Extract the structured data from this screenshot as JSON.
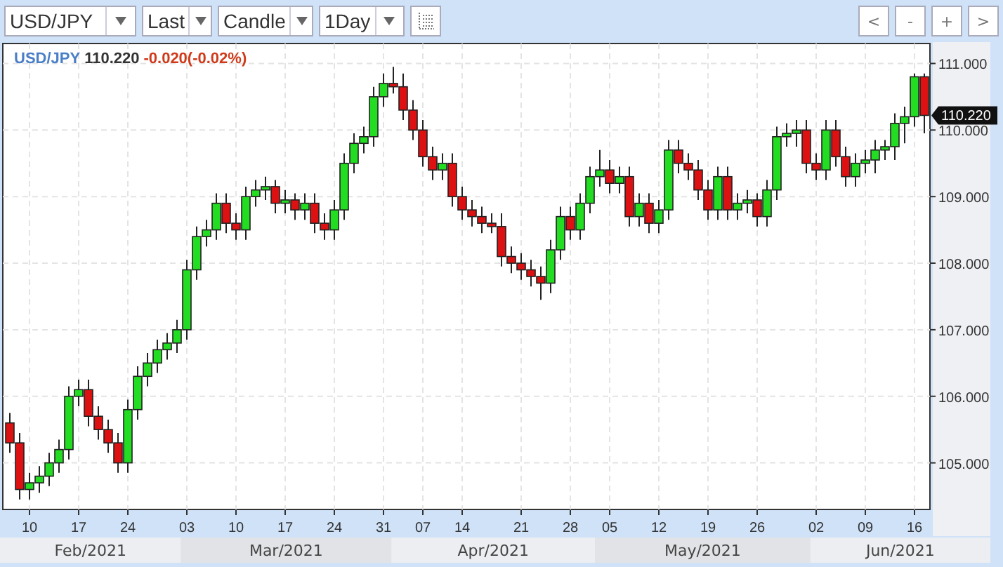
{
  "toolbar": {
    "selects": [
      {
        "value": "USD/JPY"
      },
      {
        "value": "Last"
      },
      {
        "value": "Candle"
      },
      {
        "value": "1Day"
      }
    ],
    "nav_buttons": [
      "<",
      "-",
      "+",
      ">"
    ]
  },
  "chart": {
    "symbol": "USD/JPY",
    "price": "110.220",
    "change": "-0.020(-0.02%)",
    "last_price_tag": "110.220",
    "months": [
      "Feb/2021",
      "Mar/2021",
      "Apr/2021",
      "May/2021",
      "Jun/2021"
    ],
    "chart_data": {
      "type": "candlestick",
      "grid": true,
      "ylim": [
        104.3,
        111.3
      ],
      "yticks": [
        {
          "value": 105,
          "label": "105.000"
        },
        {
          "value": 106,
          "label": "106.000"
        },
        {
          "value": 107,
          "label": "107.000"
        },
        {
          "value": 108,
          "label": "108.000"
        },
        {
          "value": 109,
          "label": "109.000"
        },
        {
          "value": 110,
          "label": "110.000"
        },
        {
          "value": 111,
          "label": "111.000"
        }
      ],
      "categories": [
        null,
        null,
        "10",
        null,
        null,
        null,
        null,
        "17",
        null,
        null,
        null,
        null,
        "24",
        null,
        null,
        null,
        null,
        null,
        "03",
        null,
        null,
        null,
        null,
        "10",
        null,
        null,
        null,
        null,
        "17",
        null,
        null,
        null,
        null,
        "24",
        null,
        null,
        null,
        null,
        "31",
        null,
        null,
        null,
        "07",
        null,
        null,
        null,
        "14",
        null,
        null,
        null,
        null,
        null,
        "21",
        null,
        null,
        null,
        null,
        "28",
        null,
        null,
        null,
        "05",
        null,
        null,
        null,
        null,
        "12",
        null,
        null,
        null,
        null,
        "19",
        null,
        null,
        null,
        null,
        "26",
        null,
        null,
        null,
        null,
        null,
        "02",
        null,
        null,
        null,
        null,
        "09",
        null,
        null,
        null,
        null,
        "16",
        null
      ],
      "ohlc": [
        [
          105.6,
          105.75,
          105.15,
          105.3
        ],
        [
          105.3,
          105.45,
          104.45,
          104.6
        ],
        [
          104.6,
          104.85,
          104.45,
          104.7
        ],
        [
          104.7,
          104.95,
          104.55,
          104.8
        ],
        [
          104.8,
          105.15,
          104.65,
          105.0
        ],
        [
          105.0,
          105.35,
          104.85,
          105.2
        ],
        [
          105.2,
          106.15,
          105.05,
          106.0
        ],
        [
          106.0,
          106.25,
          105.85,
          106.1
        ],
        [
          106.1,
          106.25,
          105.55,
          105.7
        ],
        [
          105.7,
          105.85,
          105.35,
          105.5
        ],
        [
          105.5,
          105.65,
          105.15,
          105.3
        ],
        [
          105.3,
          105.45,
          104.85,
          105.0
        ],
        [
          105.0,
          105.95,
          104.85,
          105.8
        ],
        [
          105.8,
          106.45,
          105.65,
          106.3
        ],
        [
          106.3,
          106.65,
          106.15,
          106.5
        ],
        [
          106.5,
          106.85,
          106.35,
          106.7
        ],
        [
          106.7,
          106.95,
          106.55,
          106.8
        ],
        [
          106.8,
          107.15,
          106.65,
          107.0
        ],
        [
          107.0,
          108.05,
          106.85,
          107.9
        ],
        [
          107.9,
          108.55,
          107.75,
          108.4
        ],
        [
          108.4,
          108.65,
          108.25,
          108.5
        ],
        [
          108.5,
          109.05,
          108.35,
          108.9
        ],
        [
          108.9,
          109.05,
          108.45,
          108.6
        ],
        [
          108.6,
          108.75,
          108.35,
          108.5
        ],
        [
          108.5,
          109.15,
          108.35,
          109.0
        ],
        [
          109.0,
          109.25,
          108.85,
          109.1
        ],
        [
          109.1,
          109.3,
          108.95,
          109.15
        ],
        [
          109.15,
          109.25,
          108.75,
          108.9
        ],
        [
          108.9,
          109.1,
          108.75,
          108.95
        ],
        [
          108.95,
          109.05,
          108.65,
          108.8
        ],
        [
          108.8,
          109.05,
          108.65,
          108.9
        ],
        [
          108.9,
          109.05,
          108.45,
          108.6
        ],
        [
          108.6,
          108.75,
          108.35,
          108.5
        ],
        [
          108.5,
          108.95,
          108.35,
          108.8
        ],
        [
          108.8,
          109.65,
          108.65,
          109.5
        ],
        [
          109.5,
          109.95,
          109.35,
          109.8
        ],
        [
          109.8,
          110.05,
          109.65,
          109.9
        ],
        [
          109.9,
          110.65,
          109.75,
          110.5
        ],
        [
          110.5,
          110.85,
          110.35,
          110.7
        ],
        [
          110.7,
          110.95,
          110.55,
          110.65
        ],
        [
          110.65,
          110.85,
          110.15,
          110.3
        ],
        [
          110.3,
          110.45,
          109.85,
          110.0
        ],
        [
          110.0,
          110.15,
          109.45,
          109.6
        ],
        [
          109.6,
          109.75,
          109.25,
          109.4
        ],
        [
          109.4,
          109.65,
          109.25,
          109.5
        ],
        [
          109.5,
          109.65,
          108.85,
          109.0
        ],
        [
          109.0,
          109.15,
          108.65,
          108.8
        ],
        [
          108.8,
          108.95,
          108.55,
          108.7
        ],
        [
          108.7,
          108.85,
          108.45,
          108.6
        ],
        [
          108.6,
          108.75,
          108.45,
          108.55
        ],
        [
          108.55,
          108.75,
          107.95,
          108.1
        ],
        [
          108.1,
          108.25,
          107.85,
          108.0
        ],
        [
          108.0,
          108.15,
          107.75,
          107.9
        ],
        [
          107.9,
          108.05,
          107.65,
          107.8
        ],
        [
          107.8,
          107.95,
          107.45,
          107.7
        ],
        [
          107.7,
          108.35,
          107.55,
          108.2
        ],
        [
          108.2,
          108.85,
          108.05,
          108.7
        ],
        [
          108.7,
          108.85,
          108.35,
          108.5
        ],
        [
          108.5,
          109.05,
          108.35,
          108.9
        ],
        [
          108.9,
          109.45,
          108.75,
          109.3
        ],
        [
          109.3,
          109.7,
          109.15,
          109.4
        ],
        [
          109.4,
          109.55,
          109.05,
          109.2
        ],
        [
          109.2,
          109.45,
          109.05,
          109.3
        ],
        [
          109.3,
          109.45,
          108.55,
          108.7
        ],
        [
          108.7,
          109.05,
          108.55,
          108.9
        ],
        [
          108.9,
          109.05,
          108.45,
          108.6
        ],
        [
          108.6,
          108.95,
          108.45,
          108.8
        ],
        [
          108.8,
          109.85,
          108.65,
          109.7
        ],
        [
          109.7,
          109.85,
          109.35,
          109.5
        ],
        [
          109.5,
          109.65,
          109.25,
          109.4
        ],
        [
          109.4,
          109.55,
          108.95,
          109.1
        ],
        [
          109.1,
          109.25,
          108.65,
          108.8
        ],
        [
          108.8,
          109.45,
          108.65,
          109.3
        ],
        [
          109.3,
          109.45,
          108.65,
          108.8
        ],
        [
          108.8,
          109.05,
          108.65,
          108.9
        ],
        [
          108.9,
          109.1,
          108.75,
          108.95
        ],
        [
          108.95,
          109.05,
          108.55,
          108.7
        ],
        [
          108.7,
          109.25,
          108.55,
          109.1
        ],
        [
          109.1,
          110.05,
          108.95,
          109.9
        ],
        [
          109.9,
          110.1,
          109.75,
          109.95
        ],
        [
          109.95,
          110.15,
          109.75,
          110.0
        ],
        [
          110.0,
          110.15,
          109.35,
          109.5
        ],
        [
          109.5,
          109.65,
          109.25,
          109.4
        ],
        [
          109.4,
          110.15,
          109.25,
          110.0
        ],
        [
          110.0,
          110.15,
          109.45,
          109.6
        ],
        [
          109.6,
          109.75,
          109.15,
          109.3
        ],
        [
          109.3,
          109.65,
          109.15,
          109.5
        ],
        [
          109.5,
          109.7,
          109.35,
          109.55
        ],
        [
          109.55,
          109.85,
          109.35,
          109.7
        ],
        [
          109.7,
          109.85,
          109.55,
          109.75
        ],
        [
          109.75,
          110.25,
          109.55,
          110.1
        ],
        [
          110.1,
          110.35,
          109.8,
          110.2
        ],
        [
          110.2,
          110.85,
          110.05,
          110.8
        ],
        [
          110.8,
          110.85,
          109.95,
          110.22
        ]
      ]
    }
  }
}
